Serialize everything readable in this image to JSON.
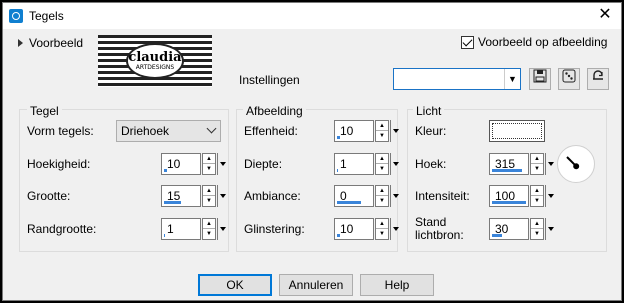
{
  "window": {
    "title": "Tegels",
    "close_glyph": "✕"
  },
  "preview": {
    "toggle_label": "Voorbeeld",
    "checkbox_label": "Voorbeeld op afbeelding",
    "checked": true
  },
  "logo": {
    "text": "claudia",
    "subtext": "ARTDESIGNS"
  },
  "settings": {
    "label": "Instellingen",
    "preset_value": ""
  },
  "tools": {
    "save_icon": "floppy-disk-icon",
    "random_icon": "dice-icon",
    "reset_icon": "reset-icon"
  },
  "tegel": {
    "title": "Tegel",
    "shape_label": "Vorm tegels:",
    "shape_value": "Driehoek",
    "angle_label": "Hoekigheid:",
    "angle_value": "10",
    "angle_pct": 0.1,
    "size_label": "Grootte:",
    "size_value": "15",
    "size_pct": 0.5,
    "border_label": "Randgrootte:",
    "border_value": "1",
    "border_pct": 0.02
  },
  "afbeelding": {
    "title": "Afbeelding",
    "smooth_label": "Effenheid:",
    "smooth_value": "10",
    "smooth_pct": 0.1,
    "depth_label": "Diepte:",
    "depth_value": "1",
    "depth_pct": 0.02,
    "ambiance_label": "Ambiance:",
    "ambiance_value": "0",
    "ambiance_pct": 0.7,
    "shine_label": "Glinstering:",
    "shine_value": "10",
    "shine_pct": 0.1
  },
  "licht": {
    "title": "Licht",
    "color_label": "Kleur:",
    "color_value": "#ffffff",
    "angle_label": "Hoek:",
    "angle_value": "315",
    "angle_pct": 0.88,
    "intensity_label": "Intensiteit:",
    "intensity_value": "100",
    "intensity_pct": 1.0,
    "stand_label_1": "Stand",
    "stand_label_2": "lichtbron:",
    "stand_value": "30",
    "stand_pct": 0.3
  },
  "buttons": {
    "ok": "OK",
    "cancel": "Annuleren",
    "help": "Help"
  },
  "colors": {
    "accent": "#0078d7",
    "slider": "#3a84d9"
  }
}
